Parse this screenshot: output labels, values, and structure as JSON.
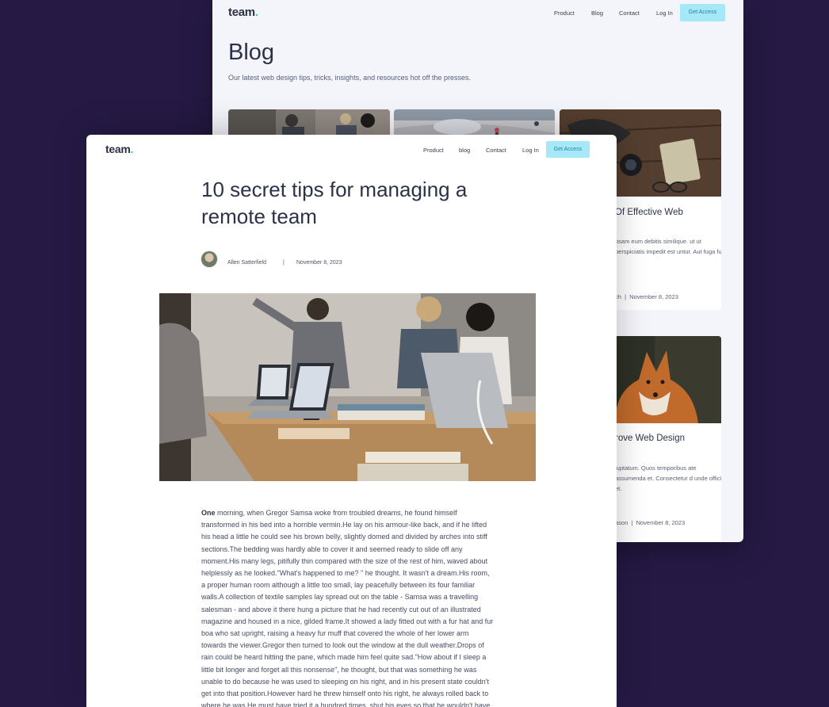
{
  "back": {
    "logo": "team",
    "logo_dot": ".",
    "nav": [
      "Product",
      "Blog",
      "Contact",
      "Log In"
    ],
    "cta": "Get Access",
    "title": "Blog",
    "subtitle": "Our latest web design tips, tricks, insights, and resources hot off the presses.",
    "cards": [
      {
        "title": "Of Effective Web",
        "excerpt": "osam eum debitis similique. ut ut perspiciatis impedit est untur. Aut fuga fu",
        "meta_author": "ch",
        "meta_sep": "|",
        "meta_date": "November 8, 2023"
      },
      {
        "title": "rove Web Design",
        "excerpt": "luptatum. Quos temporibus ate assumenda et. Consectetur d unde officia et.",
        "meta_author": "ason",
        "meta_sep": "|",
        "meta_date": "November 8, 2023"
      }
    ]
  },
  "front": {
    "logo": "team",
    "logo_dot": ".",
    "nav": [
      "Product",
      "blog",
      "Contact",
      "Log In"
    ],
    "cta": "Get Access",
    "article": {
      "title": "10 secret tips for managing a remote team",
      "author": "Allen Satterfield",
      "sep": "|",
      "date": "November 8, 2023",
      "lead_word": "One",
      "body": " morning, when Gregor Samsa woke from troubled dreams, he found himself transformed in his bed into a horrible vermin.He lay on his armour-like back, and if he lifted his head a little he could see his brown belly, slightly domed and divided by arches into stiff sections.The bedding was hardly able to cover it and seemed ready to slide off any moment.His many legs, pitifully thin compared with the size of the rest of him, waved about helplessly as he looked.\"What's happened to me? \" he thought. It wasn't a dream.His room, a proper human room although a little too small, lay peacefully between its four familiar walls.A collection of textile samples lay spread out on the table - Samsa was a travelling salesman - and above it there hung a picture that he had recently cut out of an illustrated magazine and housed in a nice, gilded frame.It showed a lady fitted out with a fur hat and fur boa who sat upright, raising a heavy fur muff that covered the whole of her lower arm towards the viewer.Gregor then turned to look out the window at the dull weather.Drops of rain could be heard hitting the pane, which made him feel quite sad.\"How about if I sleep a little bit longer and forget all this nonsense\", he thought, but that was something he was unable to do because he was used to sleeping on his right, and in his present state couldn't get into that position.However hard he threw himself onto his right, he always rolled back to where he was.He must have tried it a hundred times, shut his eyes so that he wouldn't have"
    }
  },
  "colors": {
    "background": "#261a45",
    "accent": "#a5e9f8",
    "accent_text": "#2c7ea5",
    "logo_dot": "#3ab8e8",
    "heading": "#2c3348"
  }
}
